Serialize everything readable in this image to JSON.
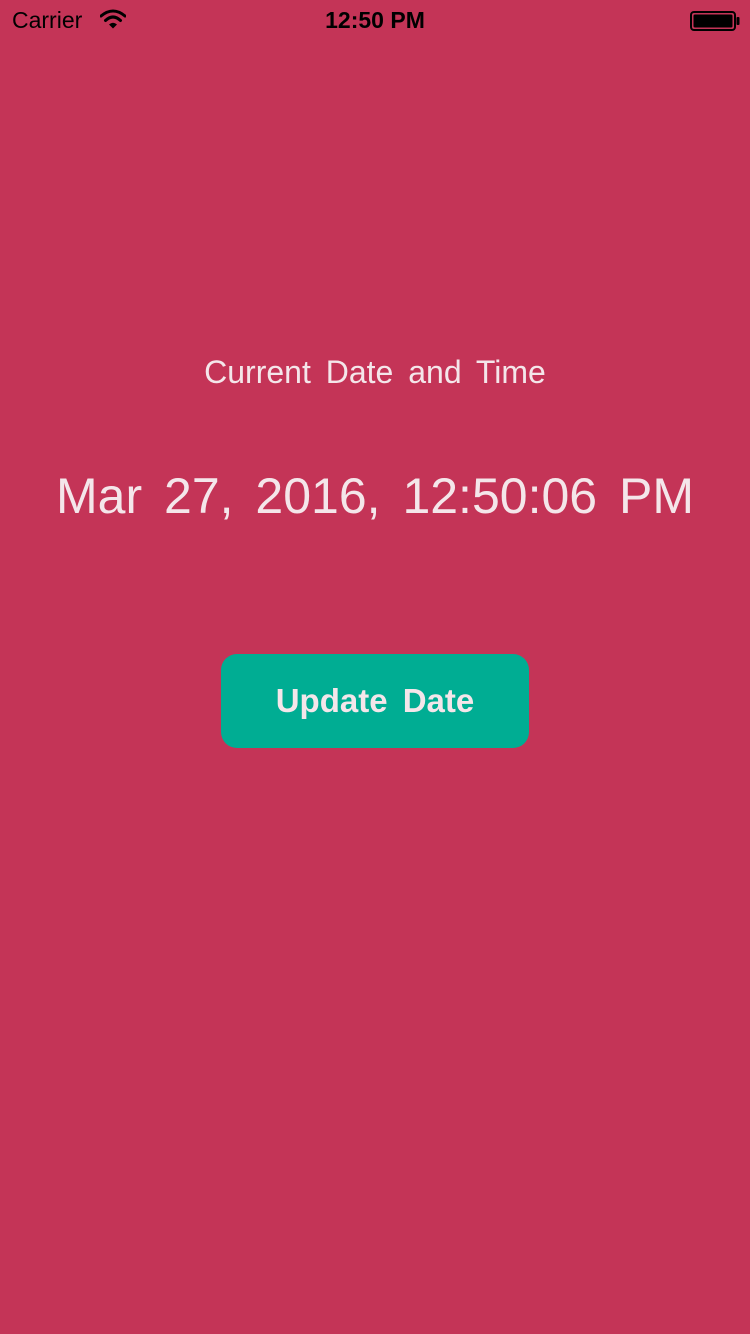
{
  "status_bar": {
    "carrier": "Carrier",
    "time": "12:50 PM",
    "wifi_icon": "wifi-icon",
    "battery_icon": "battery-icon"
  },
  "main": {
    "title": "Current Date and Time",
    "date_value": "Mar 27, 2016, 12:50:06 PM",
    "update_button_label": "Update Date"
  },
  "colors": {
    "background": "#C43457",
    "button": "#00AD93",
    "text": "#F4E6EA"
  }
}
